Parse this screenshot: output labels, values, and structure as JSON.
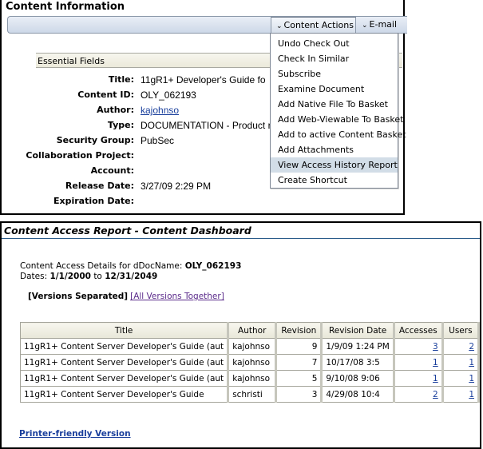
{
  "content_info": {
    "panel_title": "Content Information",
    "toolbar": {
      "content_actions_label": "Content Actions",
      "email_label": "E-mail",
      "chevron_glyph": "⌄"
    },
    "essential_fields_header": "Essential Fields",
    "fields": [
      {
        "label": "Title:",
        "value": "11gR1+ Developer's Guide fo",
        "link": false
      },
      {
        "label": "Content ID:",
        "value": "OLY_062193",
        "link": false
      },
      {
        "label": "Author:",
        "value": "kajohnso",
        "link": true
      },
      {
        "label": "Type:",
        "value": "DOCUMENTATION - Product r",
        "link": false
      },
      {
        "label": "Security Group:",
        "value": "PubSec",
        "link": false
      },
      {
        "label": "Collaboration Project:",
        "value": "",
        "link": false
      },
      {
        "label": "Account:",
        "value": "",
        "link": false
      },
      {
        "label": "Release Date:",
        "value": "3/27/09 2:29 PM",
        "link": false
      },
      {
        "label": "Expiration Date:",
        "value": "",
        "link": false
      }
    ],
    "actions_menu": {
      "items": [
        "Undo Check Out",
        "Check In Similar",
        "Subscribe",
        "Examine Document",
        "Add Native File To Basket",
        "Add Web-Viewable To Basket",
        "Add to active Content Basket",
        "Add Attachments",
        "View Access History Report",
        "Create Shortcut"
      ],
      "highlighted": "View Access History Report"
    }
  },
  "report": {
    "title": "Content Access Report - Content Dashboard",
    "details_prefix": "Content Access Details for dDocName:",
    "doc_name": "OLY_062193",
    "dates_prefix": "Dates:",
    "date_from": "1/1/2000",
    "date_to_word": "to",
    "date_to": "12/31/2049",
    "versions_selected": "[Versions Separated]",
    "versions_other_link": "[All Versions Together]",
    "table": {
      "columns": [
        "Title",
        "Author",
        "Revision",
        "Revision Date",
        "Accesses",
        "Users"
      ],
      "rows": [
        {
          "title": "11gR1+ Content Server Developer's Guide (aut",
          "author": "kajohnso",
          "revision": "9",
          "revision_date": "1/9/09 1:24 PM",
          "accesses": "3",
          "users": "2"
        },
        {
          "title": "11gR1+ Content Server Developer's Guide (aut",
          "author": "kajohnso",
          "revision": "7",
          "revision_date": "10/17/08 3:5",
          "accesses": "1",
          "users": "1"
        },
        {
          "title": "11gR1+ Content Server Developer's Guide (aut",
          "author": "kajohnso",
          "revision": "5",
          "revision_date": "9/10/08 9:06",
          "accesses": "1",
          "users": "1"
        },
        {
          "title": "11gR1+ Content Server Developer's Guide",
          "author": "schristi",
          "revision": "3",
          "revision_date": "4/29/08 10:4",
          "accesses": "2",
          "users": "1"
        }
      ]
    },
    "printer_friendly_label": "Printer-friendly Version"
  }
}
